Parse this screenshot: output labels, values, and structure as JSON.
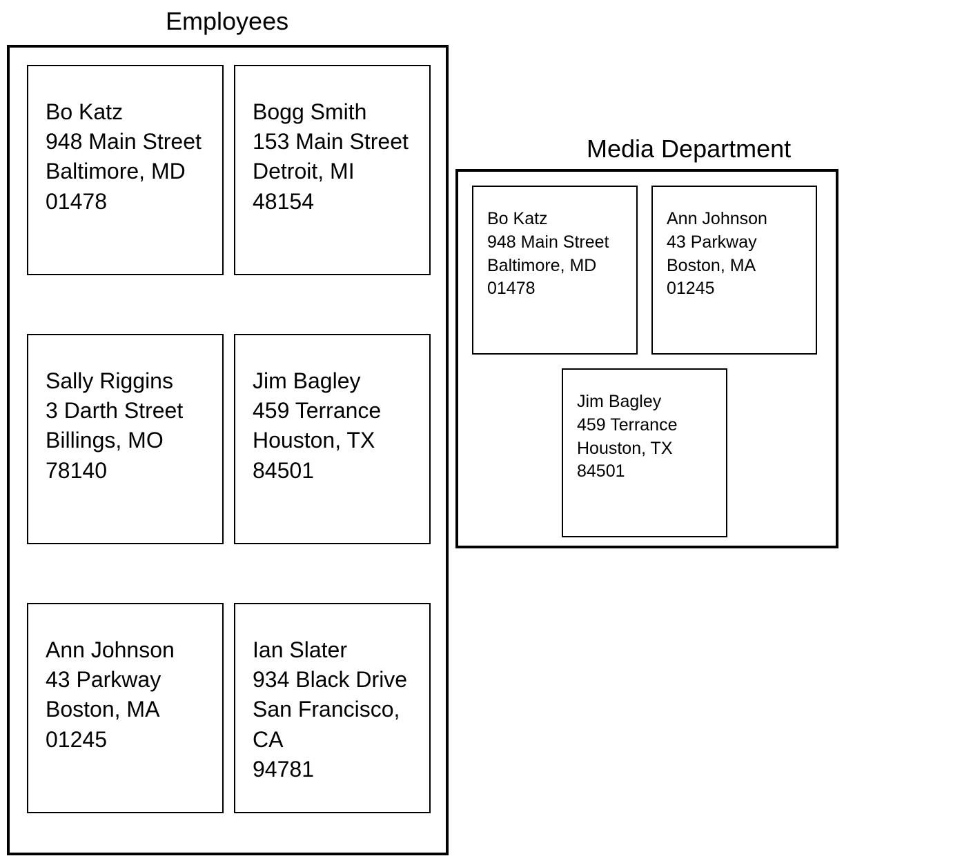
{
  "employees": {
    "title": "Employees",
    "cards": [
      {
        "name": "Bo Katz",
        "street": "948 Main Street",
        "citystate": "Baltimore, MD",
        "zip": "01478"
      },
      {
        "name": "Bogg Smith",
        "street": "153 Main Street",
        "citystate": "Detroit, MI 48154",
        "zip": ""
      },
      {
        "name": "Sally Riggins",
        "street": "3 Darth Street",
        "citystate": "Billings, MO",
        "zip": "78140"
      },
      {
        "name": "Jim Bagley",
        "street": "459 Terrance",
        "citystate": "Houston, TX",
        "zip": "84501"
      },
      {
        "name": "Ann Johnson",
        "street": "43 Parkway",
        "citystate": "Boston, MA 01245",
        "zip": ""
      },
      {
        "name": "Ian Slater",
        "street": "934 Black Drive",
        "citystate": "San Francisco, CA",
        "zip": "94781"
      }
    ]
  },
  "media": {
    "title": "Media Department",
    "cards": [
      {
        "name": "Bo Katz",
        "street": "948 Main Street",
        "citystate": "Baltimore, MD",
        "zip": "01478"
      },
      {
        "name": "Ann Johnson",
        "street": "43 Parkway",
        "citystate": "Boston, MA 01245",
        "zip": ""
      },
      {
        "name": "Jim Bagley",
        "street": "459 Terrance",
        "citystate": "Houston, TX",
        "zip": "84501"
      }
    ]
  }
}
